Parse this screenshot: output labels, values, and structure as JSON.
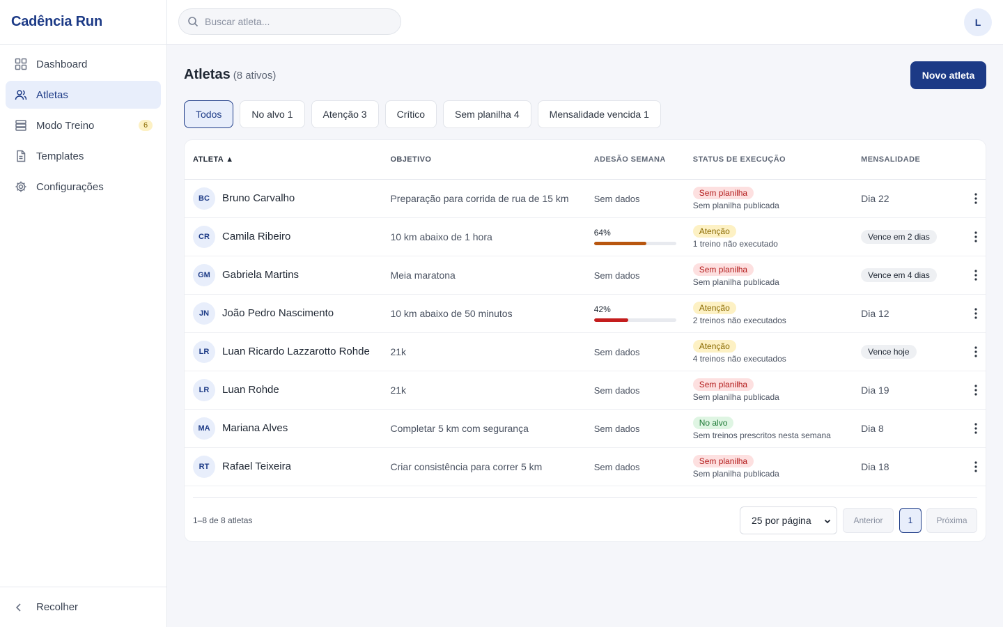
{
  "app": {
    "title": "Cadência Run"
  },
  "sidebar": {
    "items": [
      {
        "label": "Dashboard",
        "icon": "grid-icon",
        "active": false
      },
      {
        "label": "Atletas",
        "icon": "users-icon",
        "active": true
      },
      {
        "label": "Modo Treino",
        "icon": "server-icon",
        "active": false,
        "badge": "6"
      },
      {
        "label": "Templates",
        "icon": "file-icon",
        "active": false
      },
      {
        "label": "Configurações",
        "icon": "gear-icon",
        "active": false
      }
    ],
    "collapse_label": "Recolher"
  },
  "topbar": {
    "search_placeholder": "Buscar atleta...",
    "user_initial": "L"
  },
  "page": {
    "title": "Atletas",
    "subtitle": "(8 ativos)",
    "new_button": "Novo atleta"
  },
  "filters": [
    {
      "label": "Todos",
      "active": true
    },
    {
      "label": "No alvo 1",
      "active": false
    },
    {
      "label": "Atenção 3",
      "active": false
    },
    {
      "label": "Crítico",
      "active": false
    },
    {
      "label": "Sem planilha 4",
      "active": false
    },
    {
      "label": "Mensalidade vencida 1",
      "active": false
    }
  ],
  "table": {
    "headers": {
      "athlete": "ATLETA ▲",
      "goal": "OBJETIVO",
      "adherence": "ADESÃO SEMANA",
      "status": "STATUS DE EXECUÇÃO",
      "fee": "MENSALIDADE"
    },
    "rows": [
      {
        "initials": "BC",
        "name": "Bruno Carvalho",
        "goal": "Preparação para corrida de rua de 15 km",
        "adherence": null,
        "adherence_label": "Sem dados",
        "status": "Sem planilha",
        "status_color": "red",
        "status_sub": "Sem planilha publicada",
        "fee": "Dia 22",
        "fee_pill": false
      },
      {
        "initials": "CR",
        "name": "Camila Ribeiro",
        "goal": "10 km abaixo de 1 hora",
        "adherence": 64,
        "adherence_label": "64%",
        "bar_color": "#b8560f",
        "status": "Atenção",
        "status_color": "yellow",
        "status_sub": "1 treino não executado",
        "fee": "Vence em 2 dias",
        "fee_pill": true
      },
      {
        "initials": "GM",
        "name": "Gabriela Martins",
        "goal": "Meia maratona",
        "adherence": null,
        "adherence_label": "Sem dados",
        "status": "Sem planilha",
        "status_color": "red",
        "status_sub": "Sem planilha publicada",
        "fee": "Vence em 4 dias",
        "fee_pill": true
      },
      {
        "initials": "JN",
        "name": "João Pedro Nascimento",
        "goal": "10 km abaixo de 50 minutos",
        "adherence": 42,
        "adherence_label": "42%",
        "bar_color": "#c41d1d",
        "status": "Atenção",
        "status_color": "yellow",
        "status_sub": "2 treinos não executados",
        "fee": "Dia 12",
        "fee_pill": false
      },
      {
        "initials": "LR",
        "name": "Luan Ricardo Lazzarotto Rohde",
        "goal": "21k",
        "adherence": null,
        "adherence_label": "Sem dados",
        "status": "Atenção",
        "status_color": "yellow",
        "status_sub": "4 treinos não executados",
        "fee": "Vence hoje",
        "fee_pill": true
      },
      {
        "initials": "LR",
        "name": "Luan Rohde",
        "goal": "21k",
        "adherence": null,
        "adherence_label": "Sem dados",
        "status": "Sem planilha",
        "status_color": "red",
        "status_sub": "Sem planilha publicada",
        "fee": "Dia 19",
        "fee_pill": false
      },
      {
        "initials": "MA",
        "name": "Mariana Alves",
        "goal": "Completar 5 km com segurança",
        "adherence": null,
        "adherence_label": "Sem dados",
        "status": "No alvo",
        "status_color": "green",
        "status_sub": "Sem treinos prescritos nesta semana",
        "fee": "Dia 8",
        "fee_pill": false
      },
      {
        "initials": "RT",
        "name": "Rafael Teixeira",
        "goal": "Criar consistência para correr 5 km",
        "adherence": null,
        "adherence_label": "Sem dados",
        "status": "Sem planilha",
        "status_color": "red",
        "status_sub": "Sem planilha publicada",
        "fee": "Dia 18",
        "fee_pill": false
      }
    ]
  },
  "pagination": {
    "count_label": "1–8 de 8 atletas",
    "per_page": "25 por página",
    "prev": "Anterior",
    "current": "1",
    "next": "Próxima"
  },
  "colors": {
    "accent": "#1c3a86",
    "accent_light": "#e8eefb"
  }
}
